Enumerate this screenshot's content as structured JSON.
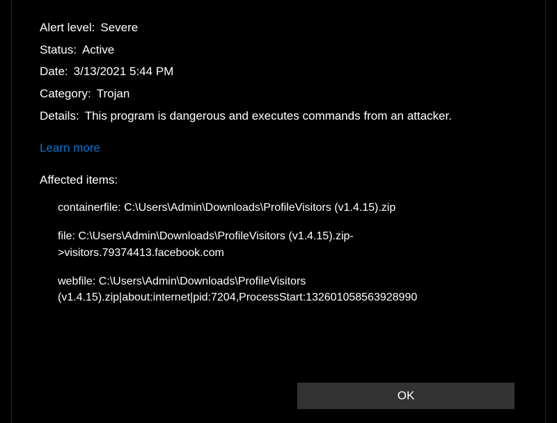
{
  "fields": {
    "alertLevel": {
      "label": "Alert level",
      "value": "Severe"
    },
    "status": {
      "label": "Status",
      "value": "Active"
    },
    "date": {
      "label": "Date",
      "value": "3/13/2021 5:44 PM"
    },
    "category": {
      "label": "Category",
      "value": "Trojan"
    },
    "details": {
      "label": "Details",
      "value": "This program is dangerous and executes commands from an attacker."
    }
  },
  "learnMore": "Learn more",
  "affectedHeading": "Affected items:",
  "affectedItems": [
    "containerfile: C:\\Users\\Admin\\Downloads\\ProfileVisitors (v1.4.15).zip",
    "file: C:\\Users\\Admin\\Downloads\\ProfileVisitors (v1.4.15).zip->visitors.79374413.facebook.com",
    "webfile: C:\\Users\\Admin\\Downloads\\ProfileVisitors (v1.4.15).zip|about:internet|pid:7204,ProcessStart:132601058563928990"
  ],
  "okButton": "OK"
}
